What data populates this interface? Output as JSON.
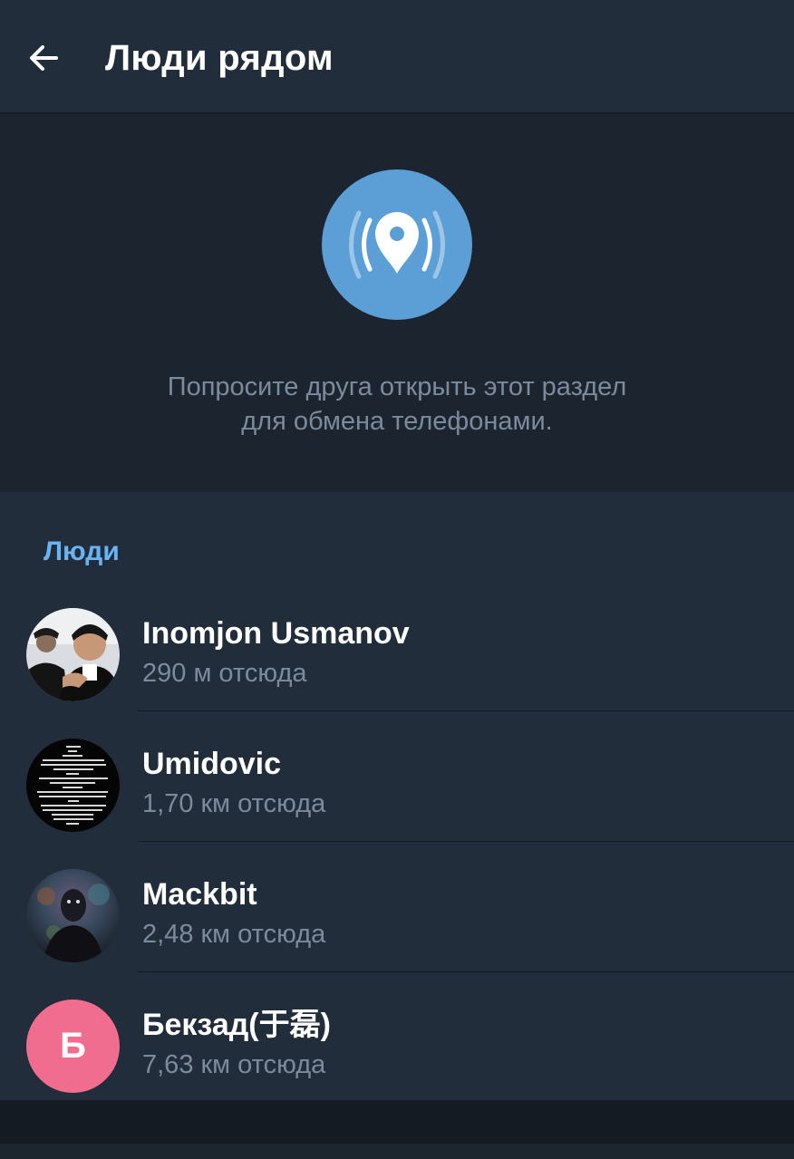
{
  "appbar": {
    "title": "Люди рядом",
    "back_icon": "arrow-left-icon"
  },
  "hero": {
    "icon": "location-broadcast-icon",
    "line1": "Попросите друга открыть этот раздел",
    "line2": "для обмена телефонами."
  },
  "people": {
    "header": "Люди",
    "items": [
      {
        "name": "Inomjon Usmanov",
        "distance": "290 м отсюда",
        "avatar": "photo"
      },
      {
        "name": "Umidovic",
        "distance": "1,70 км отсюда",
        "avatar": "photo"
      },
      {
        "name": "Mackbit",
        "distance": "2,48 км отсюда",
        "avatar": "photo"
      },
      {
        "name": "Бекзад(于磊)",
        "distance": "7,63 км отсюда",
        "avatar": "letter",
        "initial": "Б"
      }
    ]
  },
  "colors": {
    "accent": "#6ab3f3",
    "hero_circle": "#5c9fd6",
    "letter_avatar": "#f06d8f"
  }
}
